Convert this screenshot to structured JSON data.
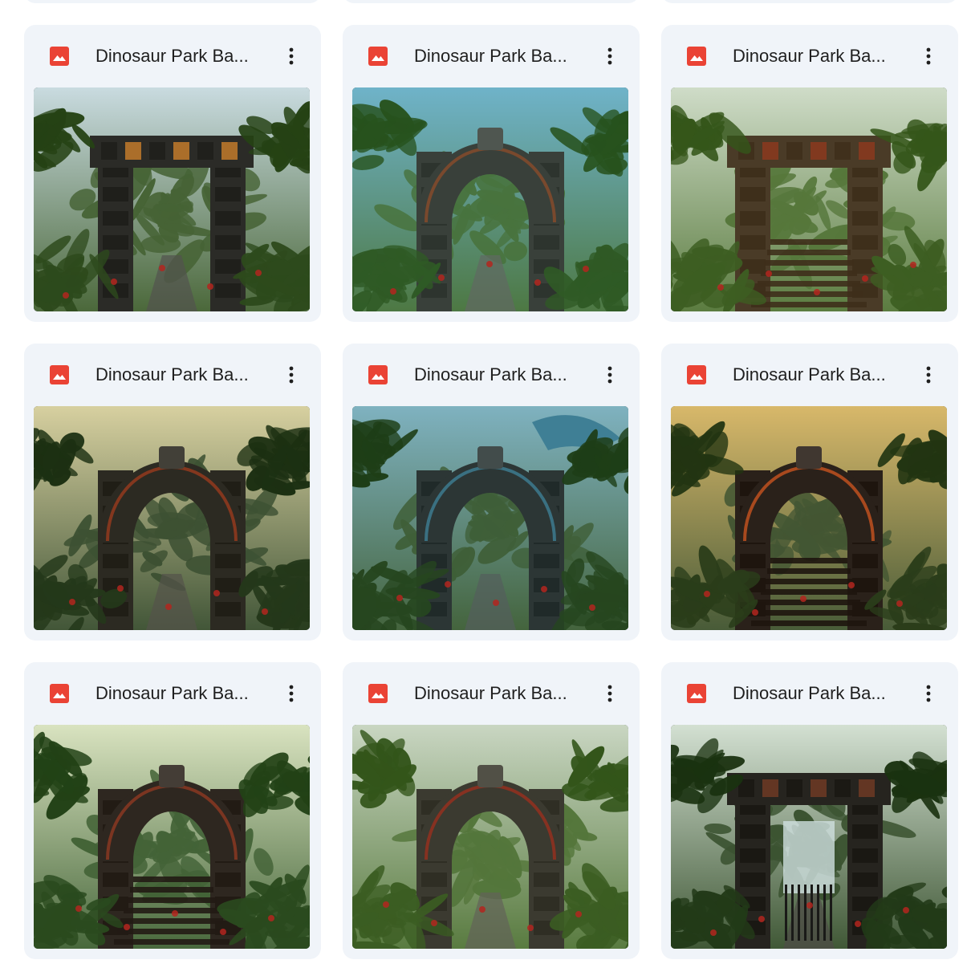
{
  "files": [
    {
      "name": "Dinosaur Park Ba...",
      "thumbnail": {
        "theme": "stone-gate-square",
        "sky": "#c9dbe0",
        "stone": "#2b2b27",
        "foliage": "#2d4a1c",
        "accent": "#c27a2c"
      }
    },
    {
      "name": "Dinosaur Park Ba...",
      "thumbnail": {
        "theme": "arch-with-statues",
        "sky": "#6fb3c9",
        "stone": "#39403a",
        "foliage": "#2f5a25",
        "accent": "#8a4b2a"
      }
    },
    {
      "name": "Dinosaur Park Ba...",
      "thumbnail": {
        "theme": "gate-with-stairs",
        "sky": "#cfdcc8",
        "stone": "#4a3b27",
        "foliage": "#3d5e22",
        "accent": "#8b3a1f"
      }
    },
    {
      "name": "Dinosaur Park Ba...",
      "thumbnail": {
        "theme": "overgrown-arch",
        "sky": "#d7d0a0",
        "stone": "#2c2a22",
        "foliage": "#24381a",
        "accent": "#9a3b1e"
      }
    },
    {
      "name": "Dinosaur Park Ba...",
      "thumbnail": {
        "theme": "arch-with-dinosaur",
        "sky": "#7fb2c0",
        "stone": "#2c3635",
        "foliage": "#26461f",
        "accent": "#3f7f95"
      }
    },
    {
      "name": "Dinosaur Park Ba...",
      "thumbnail": {
        "theme": "glowing-arch",
        "sky": "#d8b86a",
        "stone": "#2a211a",
        "foliage": "#2a3d1a",
        "accent": "#c8541f"
      }
    },
    {
      "name": "Dinosaur Park Ba...",
      "thumbnail": {
        "theme": "red-stone-arch",
        "sky": "#d9e3c0",
        "stone": "#2e2720",
        "foliage": "#2a4a1e",
        "accent": "#8e3a22"
      }
    },
    {
      "name": "Dinosaur Park Ba...",
      "thumbnail": {
        "theme": "carved-stone-arch",
        "sky": "#c9d6c2",
        "stone": "#3b3a30",
        "foliage": "#3b5d22",
        "accent": "#9a2f1e"
      }
    },
    {
      "name": "Dinosaur Park Ba...",
      "thumbnail": {
        "theme": "gate-with-waterfall",
        "sky": "#d3e0d2",
        "stone": "#26241f",
        "foliage": "#223a18",
        "accent": "#6e3a24"
      }
    }
  ],
  "icons": {
    "file_type": "image-file-icon",
    "menu": "more-vert-icon"
  },
  "colors": {
    "card_bg": "#f0f4f9",
    "icon_red": "#ea4335",
    "text": "#1f1f1f"
  }
}
